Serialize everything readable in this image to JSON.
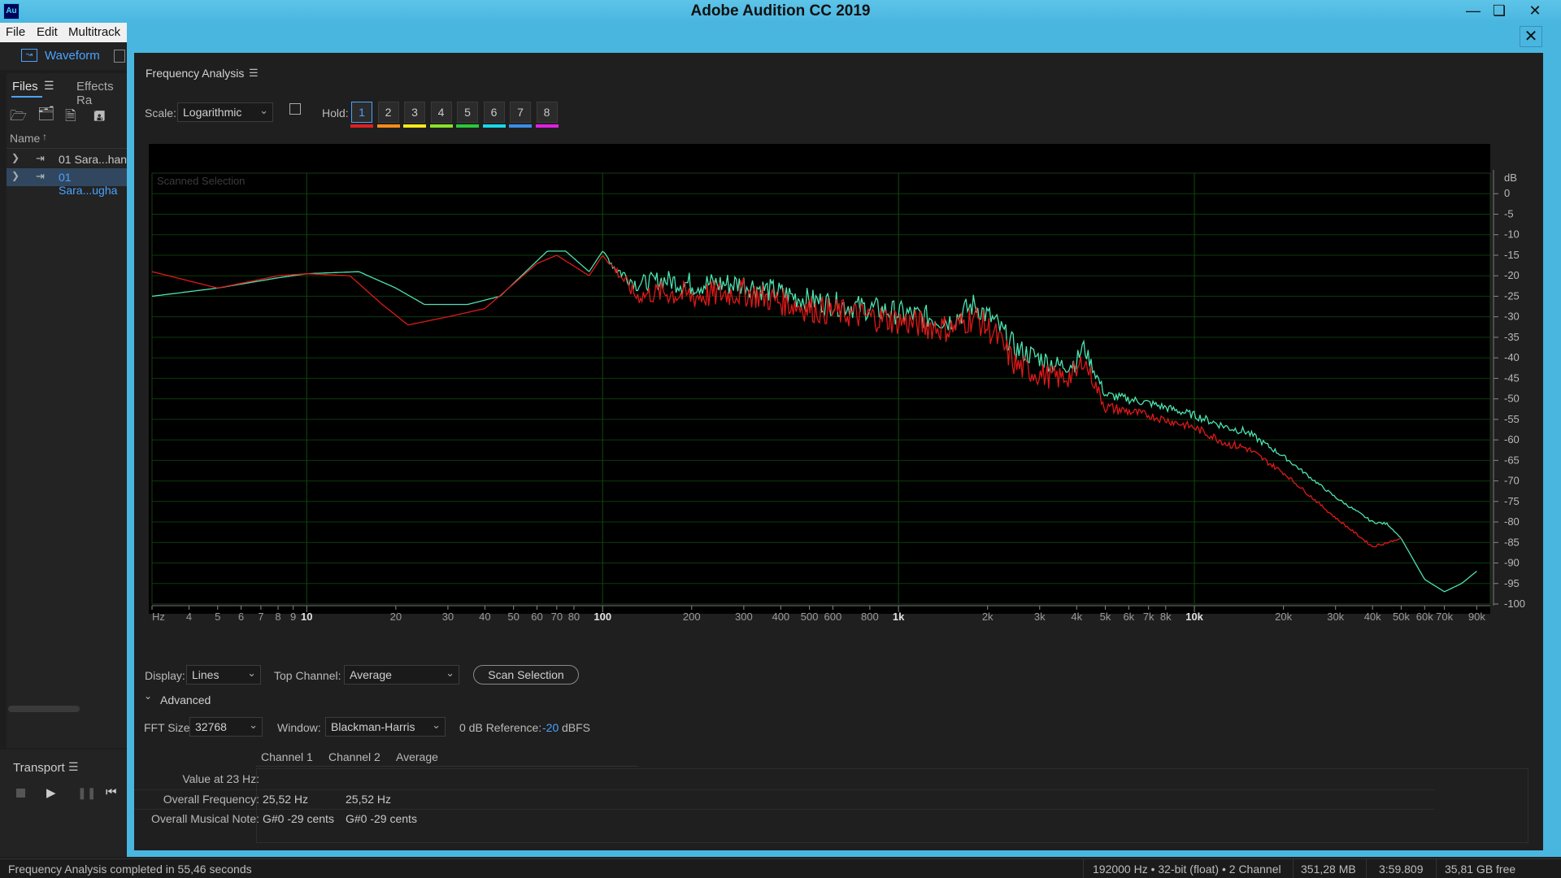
{
  "app": {
    "title": "Adobe Audition CC 2019",
    "icon_text": "Au",
    "minimize_icon": "minimize-icon",
    "restore_icon": "restore-icon",
    "close_icon": "close-icon"
  },
  "menu": [
    "File",
    "Edit",
    "Multitrack"
  ],
  "toolbar": {
    "waveform_label": "Waveform"
  },
  "files_panel": {
    "tabs": [
      "Files",
      "Effects Ra"
    ],
    "column_header": "Name",
    "files": [
      "01 Sara...han",
      "01 Sara...ugha"
    ]
  },
  "transport": {
    "label": "Transport"
  },
  "dialog": {
    "title": "Frequency Analysis",
    "scale_label": "Scale:",
    "scale_value": "Logarithmic",
    "hold_label": "Hold:",
    "hold_buttons": [
      "1",
      "2",
      "3",
      "4",
      "5",
      "6",
      "7",
      "8"
    ],
    "hold_colors": [
      "#e02020",
      "#ff8c1a",
      "#ffe81a",
      "#8ce02a",
      "#2ac83a",
      "#1ad8e8",
      "#3a8ee8",
      "#e020e0"
    ],
    "display_label": "Display:",
    "display_value": "Lines",
    "top_channel_label": "Top Channel:",
    "top_channel_value": "Average",
    "scan_button": "Scan Selection",
    "advanced_label": "Advanced",
    "fft_label": "FFT Size:",
    "fft_value": "32768",
    "window_label": "Window:",
    "window_value": "Blackman-Harris",
    "ref_label": "0 dB Reference:",
    "ref_value": "-20",
    "ref_unit": "dBFS",
    "table": {
      "headers": [
        "Channel 1",
        "Channel 2",
        "Average"
      ],
      "rows": [
        {
          "label": "Value at 23 Hz:",
          "values": [
            "",
            "",
            ""
          ]
        },
        {
          "label": "Overall Frequency:",
          "values": [
            "25,52 Hz",
            "25,52 Hz",
            ""
          ]
        },
        {
          "label": "Overall Musical Note:",
          "values": [
            "G#0 -29 cents",
            "G#0 -29 cents",
            ""
          ]
        }
      ]
    }
  },
  "status": {
    "left": "Frequency Analysis completed in 55,46 seconds",
    "format": "192000 Hz • 32-bit (float) • 2 Channel",
    "memory": "351,28 MB",
    "duration": "3:59.809",
    "free": "35,81 GB free"
  },
  "chart_data": {
    "type": "line",
    "title": "Scanned Selection",
    "xlabel": "Hz",
    "ylabel": "dB",
    "xscale": "log",
    "xlim": [
      1,
      100000
    ],
    "ylim": [
      -100,
      5
    ],
    "grid": true,
    "x_tick_labels": [
      "Hz",
      "4",
      "5",
      "6",
      "7",
      "8",
      "9",
      "10",
      "20",
      "30",
      "40",
      "50",
      "60",
      "70",
      "80",
      "100",
      "200",
      "300",
      "400",
      "500",
      "600",
      "800",
      "1k",
      "2k",
      "3k",
      "4k",
      "5k",
      "6k",
      "7k",
      "8k",
      "10k",
      "20k",
      "30k",
      "40k",
      "50k",
      "60k",
      "70k",
      "90k"
    ],
    "x_tick_values": [
      3,
      4,
      5,
      6,
      7,
      8,
      9,
      10,
      20,
      30,
      40,
      50,
      60,
      70,
      80,
      100,
      200,
      300,
      400,
      500,
      600,
      800,
      1000,
      2000,
      3000,
      4000,
      5000,
      6000,
      7000,
      8000,
      10000,
      20000,
      30000,
      40000,
      50000,
      60000,
      70000,
      90000
    ],
    "y_tick_labels": [
      "dB",
      "0",
      "-5",
      "-10",
      "-15",
      "-20",
      "-25",
      "-30",
      "-35",
      "-40",
      "-45",
      "-50",
      "-55",
      "-60",
      "-65",
      "-70",
      "-75",
      "-80",
      "-85",
      "-90",
      "-95",
      "-100"
    ],
    "series": [
      {
        "color": "#4de3b0",
        "x": [
          3,
          5,
          8,
          10,
          15,
          20,
          25,
          35,
          45,
          55,
          65,
          75,
          90,
          100,
          110,
          130,
          160,
          200,
          300,
          500,
          800,
          1000,
          1500,
          1800,
          2100,
          2500,
          3000,
          3500,
          4000,
          4200,
          5000,
          7000,
          10000,
          13000,
          15000,
          20000,
          30000,
          40000,
          45000,
          50000,
          60000,
          70000,
          80000,
          90000
        ],
        "y": [
          -25,
          -23,
          -20.5,
          -19.5,
          -19,
          -23,
          -27,
          -27,
          -25,
          -19,
          -14,
          -14,
          -19,
          -14,
          -18,
          -22,
          -21,
          -22,
          -22,
          -26,
          -28,
          -29,
          -31,
          -27,
          -31,
          -38,
          -40,
          -42,
          -41,
          -37,
          -49,
          -51,
          -54,
          -57,
          -58,
          -64,
          -74,
          -80,
          -80.5,
          -84,
          -94,
          -97,
          -95,
          -92
        ],
        "noise": [
          0,
          0,
          0,
          0,
          0,
          0,
          0,
          0,
          0,
          0,
          0,
          0,
          0,
          0,
          1.5,
          2,
          2.5,
          3,
          3,
          3,
          3,
          3,
          3,
          3,
          3,
          3,
          2.5,
          2.5,
          2.5,
          2,
          1.2,
          1,
          1,
          1,
          1,
          0.5,
          0.3,
          0.3,
          0.3,
          0,
          0,
          0,
          0,
          0
        ]
      },
      {
        "color": "#e01818",
        "x": [
          3,
          5,
          8,
          10,
          14,
          18,
          22,
          30,
          40,
          50,
          60,
          70,
          90,
          100,
          115,
          130,
          160,
          200,
          300,
          500,
          800,
          1000,
          1500,
          1800,
          2100,
          2500,
          3000,
          3500,
          4000,
          4200,
          5000,
          7000,
          10000,
          13000,
          15000,
          20000,
          30000,
          40000,
          45000,
          50000
        ],
        "y": [
          -19,
          -23,
          -20,
          -19.5,
          -20,
          -27,
          -32,
          -30,
          -28,
          -22,
          -17,
          -15,
          -20,
          -15,
          -20,
          -25,
          -24,
          -25,
          -24,
          -28,
          -30,
          -31,
          -33,
          -30,
          -34,
          -42,
          -44,
          -45,
          -44,
          -40,
          -52,
          -54,
          -57,
          -61,
          -62,
          -68,
          -79,
          -86,
          -85,
          -84
        ],
        "noise": [
          0,
          0,
          0,
          0,
          0,
          0,
          0,
          0,
          0,
          0,
          0,
          0,
          0,
          0,
          1.5,
          2,
          3,
          3.5,
          3.5,
          3.5,
          3.5,
          3.5,
          3.5,
          3.5,
          3.5,
          3.5,
          3,
          3,
          3,
          2.5,
          1.5,
          1,
          1,
          1,
          1,
          0.5,
          0.3,
          0.3,
          0.3,
          0
        ]
      }
    ]
  }
}
